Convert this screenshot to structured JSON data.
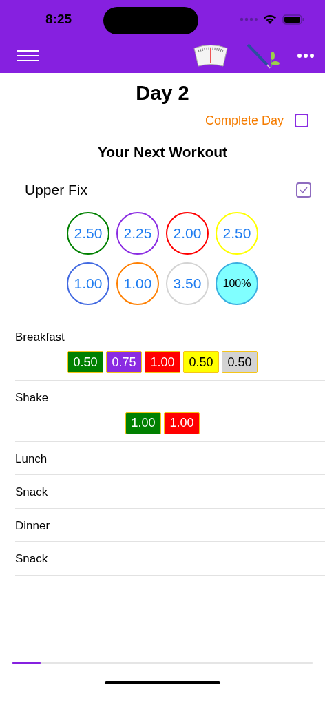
{
  "status_bar": {
    "time": "8:25"
  },
  "title": "Day 2",
  "complete_day": {
    "label": "Complete Day",
    "checked": false
  },
  "section_title": "Your Next Workout",
  "workout": {
    "name": "Upper Fix",
    "checked": true
  },
  "containers": [
    {
      "value": "2.50",
      "color": "#008000",
      "kind": "ring"
    },
    {
      "value": "2.25",
      "color": "#8a2be2",
      "kind": "ring"
    },
    {
      "value": "2.00",
      "color": "#ff0000",
      "kind": "ring"
    },
    {
      "value": "2.50",
      "color": "#ffff00",
      "kind": "ring"
    },
    {
      "value": "1.00",
      "color": "#4169e1",
      "kind": "ring"
    },
    {
      "value": "1.00",
      "color": "#ff7f00",
      "kind": "ring"
    },
    {
      "value": "3.50",
      "color": "#d3d3d3",
      "kind": "ring"
    },
    {
      "value": "100%",
      "color": "#80ffff",
      "kind": "filled"
    }
  ],
  "meals": [
    {
      "name": "Breakfast",
      "portions": [
        {
          "value": "0.50",
          "color": "#008000"
        },
        {
          "value": "0.75",
          "color": "#8a2be2"
        },
        {
          "value": "1.00",
          "color": "#ff0000"
        },
        {
          "value": "0.50",
          "color": "#ffff00"
        },
        {
          "value": "0.50",
          "color": "#d3d3d3"
        }
      ]
    },
    {
      "name": "Shake",
      "portions": [
        {
          "value": "1.00",
          "color": "#008000"
        },
        {
          "value": "1.00",
          "color": "#ff0000"
        }
      ]
    },
    {
      "name": "Lunch"
    },
    {
      "name": "Snack"
    },
    {
      "name": "Dinner"
    },
    {
      "name": "Snack"
    }
  ],
  "progress": {
    "level": 0.095
  }
}
